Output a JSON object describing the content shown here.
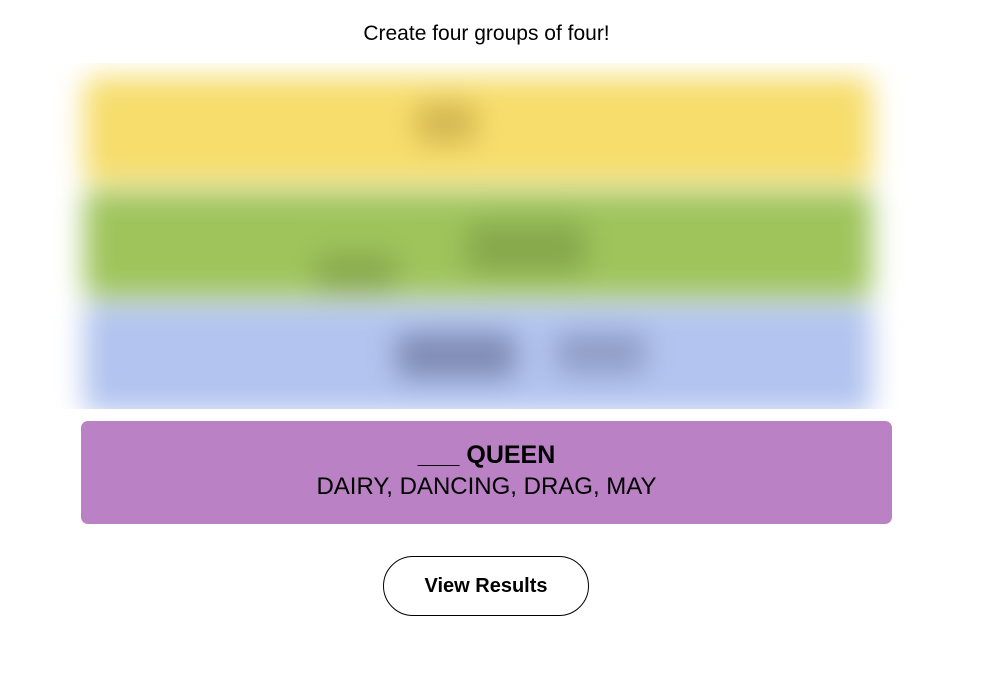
{
  "instructions": "Create four groups of four!",
  "colors": {
    "yellow_group": "#f6dd6c",
    "green_group": "#9fc45c",
    "blue_group": "#b2c4ef",
    "purple_group": "#ba81c5",
    "text": "#000000",
    "background": "#ffffff"
  },
  "solved_group": {
    "title": "___ QUEEN",
    "members": "DAIRY, DANCING, DRAG, MAY"
  },
  "actions": {
    "view_results_label": "View Results"
  }
}
